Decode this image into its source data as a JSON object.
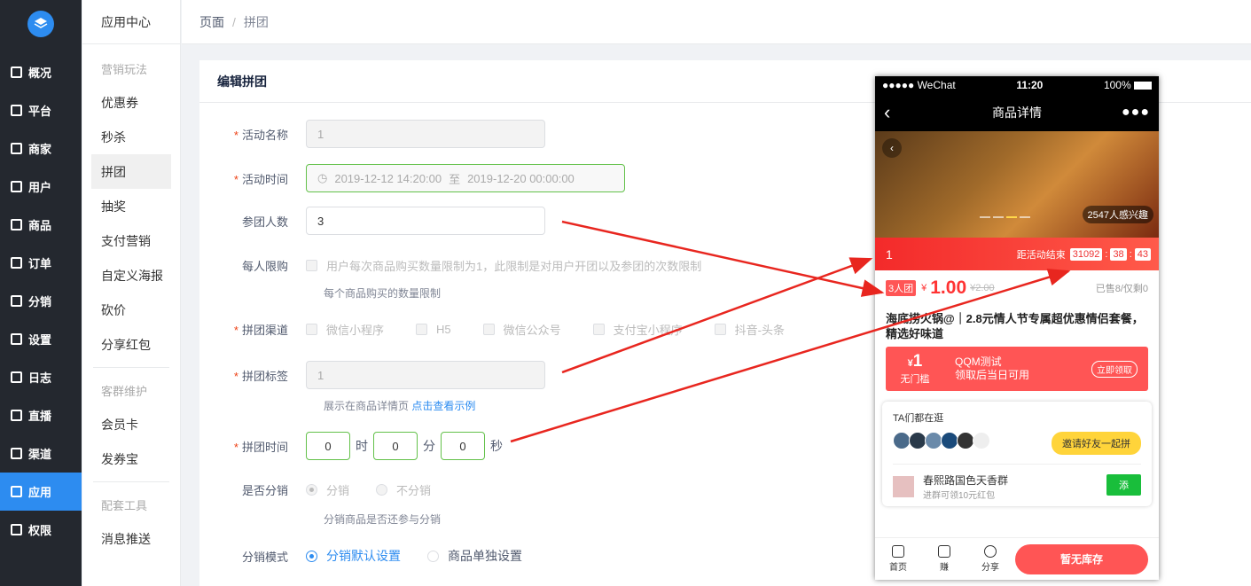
{
  "sidebar": {
    "items": [
      {
        "label": "概况",
        "icon": "overview-icon"
      },
      {
        "label": "平台",
        "icon": "platform-icon"
      },
      {
        "label": "商家",
        "icon": "merchant-icon"
      },
      {
        "label": "用户",
        "icon": "user-icon"
      },
      {
        "label": "商品",
        "icon": "goods-icon"
      },
      {
        "label": "订单",
        "icon": "order-icon"
      },
      {
        "label": "分销",
        "icon": "distribution-icon"
      },
      {
        "label": "设置",
        "icon": "settings-icon"
      },
      {
        "label": "日志",
        "icon": "log-icon"
      },
      {
        "label": "直播",
        "icon": "live-icon"
      },
      {
        "label": "渠道",
        "icon": "channel-icon"
      },
      {
        "label": "应用",
        "icon": "apps-icon"
      },
      {
        "label": "权限",
        "icon": "lock-icon"
      }
    ],
    "active_color": "#2d8cf0"
  },
  "submenu": {
    "head": "应用中心",
    "groups": [
      {
        "title": "营销玩法",
        "items": [
          "优惠券",
          "秒杀",
          "拼团",
          "抽奖",
          "支付营销",
          "自定义海报",
          "砍价",
          "分享红包"
        ]
      },
      {
        "title": "客群维护",
        "items": [
          "会员卡",
          "发券宝"
        ]
      },
      {
        "title": "配套工具",
        "items": [
          "消息推送"
        ]
      }
    ]
  },
  "breadcrumb": {
    "root": "页面",
    "sep": "/",
    "current": "拼团"
  },
  "form": {
    "title": "编辑拼团",
    "name_label": "活动名称",
    "name_value": "1",
    "time_label": "活动时间",
    "time_start": "2019-12-12 14:20:00",
    "time_to": "至",
    "time_end": "2019-12-20 00:00:00",
    "people_label": "参团人数",
    "people_value": "3",
    "limit_label": "每人限购",
    "limit_text": "用户每次商品购买数量限制为1，此限制是对用户开团以及参团的次数限制",
    "limit_hint": "每个商品购买的数量限制",
    "channel_label": "拼团渠道",
    "channels": [
      "微信小程序",
      "H5",
      "微信公众号",
      "支付宝小程序",
      "抖音-头条"
    ],
    "tag_label": "拼团标签",
    "tag_value": "1",
    "tag_hint": "展示在商品详情页",
    "tag_link": "点击查看示例",
    "duration_label": "拼团时间",
    "hours": "0",
    "hour_unit": "时",
    "minutes": "0",
    "minute_unit": "分",
    "seconds": "0",
    "second_unit": "秒",
    "dist_label": "是否分销",
    "dist_yes": "分销",
    "dist_no": "不分销",
    "dist_hint": "分销商品是否还参与分销",
    "mode_label": "分销模式",
    "mode_default": "分销默认设置",
    "mode_single": "商品单独设置"
  },
  "phone": {
    "carrier": "●●●●● WeChat",
    "time": "11:20",
    "battery": "100%",
    "nav_title": "商品详情",
    "back": "‹",
    "more": "●●●",
    "interest": "2547人感兴趣",
    "group_name": "1",
    "countdown_label": "距活动结束",
    "cd_h": "31092",
    "cd_m": "38",
    "cd_s": "43",
    "tag": "3人团",
    "yen": "¥",
    "price": "1.00",
    "orig": "¥2.00",
    "sold": "已售8/仅剩0",
    "title": "海底捞火锅@｜2.8元情人节专属超优惠情侣套餐，精选好味道",
    "coupon_amount": "1",
    "coupon_yen": "¥",
    "coupon_cond": "无门槛",
    "coupon_name": "QQM测试",
    "coupon_desc": "领取后当日可用",
    "coupon_btn": "立即领取",
    "group_title": "TA们都在逛",
    "invite": "邀请好友一起拼",
    "store_name": "春熙路国色天香群",
    "store_sub": "进群可领10元红包",
    "join": "添",
    "footer": [
      "首页",
      "赚",
      "分享"
    ],
    "buy": "暂无库存"
  }
}
